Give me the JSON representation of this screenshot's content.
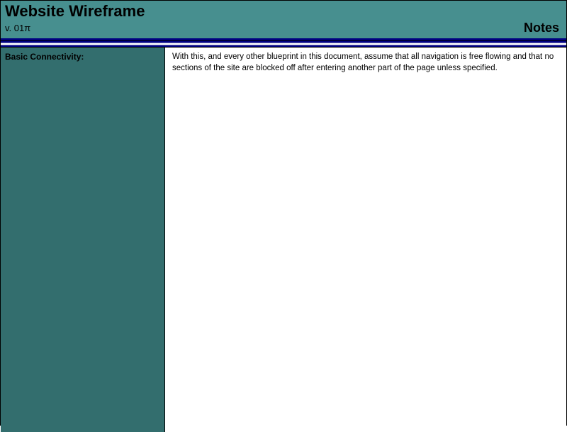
{
  "header": {
    "title": "Website Wireframe",
    "version": "v. 01π",
    "notes_label": "Notes"
  },
  "sidebar": {
    "heading": "Basic Connectivity:"
  },
  "main": {
    "body_text": "With this, and every other blueprint in this document, assume that all navigation is free flowing and that no sections of the site are blocked off after entering another part of the page unless specified."
  }
}
